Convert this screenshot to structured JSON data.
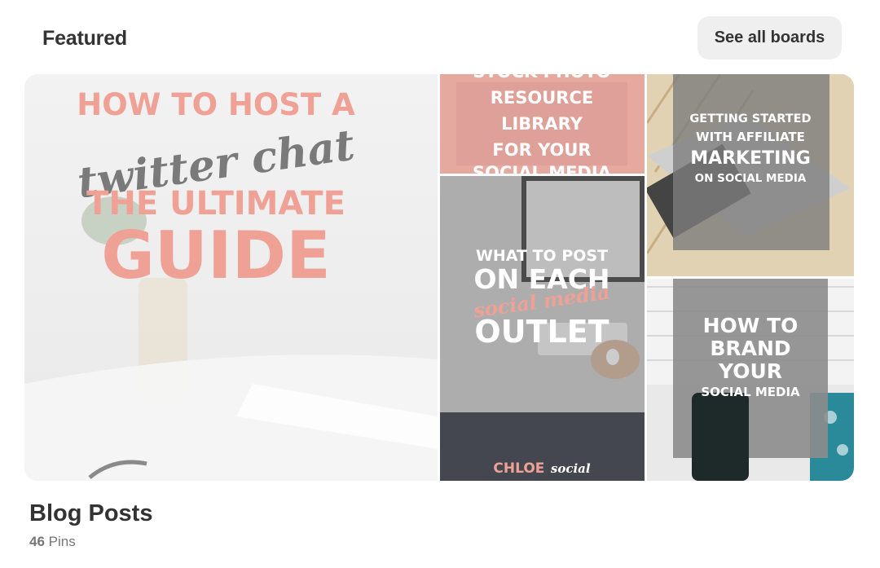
{
  "header": {
    "title": "Featured",
    "see_all_label": "See all boards"
  },
  "board": {
    "name": "Blog Posts",
    "pin_count": "46",
    "pin_label": "Pins"
  },
  "pins": {
    "main": {
      "line1": "HOW TO HOST A",
      "line2": "twitter chat",
      "line3": "THE ULTIMATE",
      "line4": "GUIDE"
    },
    "top_middle": {
      "line0": "STOCK PHOTO",
      "line1": "RESOURCE",
      "line2": "LIBRARY",
      "line3": "FOR YOUR",
      "line4": "SOCIAL MEDIA"
    },
    "middle": {
      "line1": "WHAT TO POST",
      "line2": "ON EACH",
      "line3": "social media",
      "line4": "OUTLET",
      "brand_bold": "CHLOE",
      "brand_script": "social"
    },
    "top_right": {
      "line1": "GETTING STARTED",
      "line2": "WITH AFFILIATE",
      "line3": "MARKETING",
      "line4": "ON SOCIAL MEDIA"
    },
    "bottom_right": {
      "line1": "HOW TO",
      "line2": "BRAND",
      "line3": "YOUR",
      "line4": "SOCIAL MEDIA"
    }
  },
  "colors": {
    "pink": "#f0a195",
    "gray_text": "#7a7a7a",
    "overlay_gray": "#8c8c8c"
  }
}
